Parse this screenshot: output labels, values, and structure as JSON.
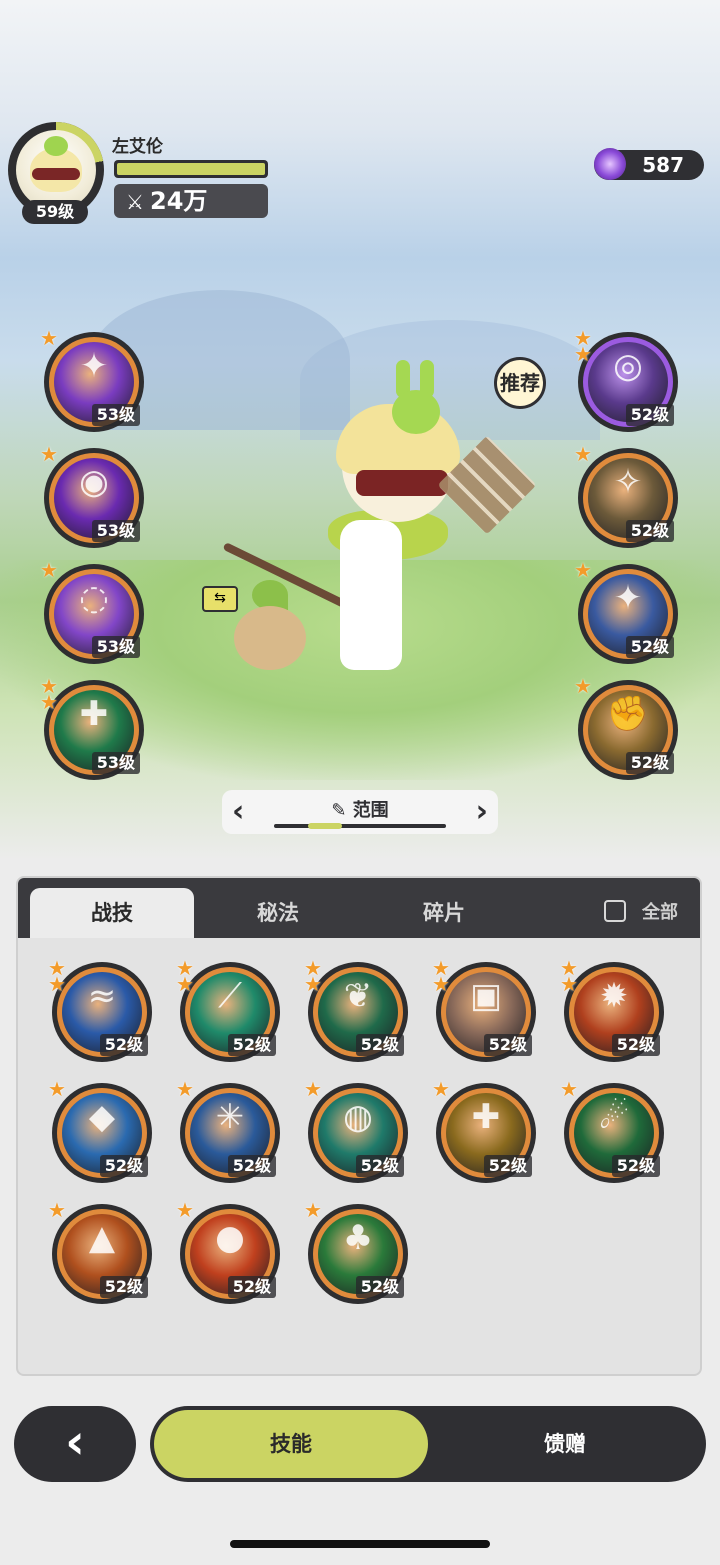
{
  "player": {
    "name": "左艾伦",
    "level": "59级",
    "power": "24万",
    "power_icon": "crossed-swords-icon",
    "xp_fraction": 0.22,
    "hp_fraction": 1.0
  },
  "currency": {
    "amount": "587",
    "icon": "purple-gem-icon"
  },
  "recommend_label": "推荐",
  "left_skills": [
    {
      "level": "53级",
      "stars": 1,
      "icon": "purple-sparkle-icon",
      "color": "#7a3cc0"
    },
    {
      "level": "53级",
      "stars": 1,
      "icon": "purple-eye-icon",
      "color": "#6a2ab0"
    },
    {
      "level": "53级",
      "stars": 1,
      "icon": "purple-swirl-icon",
      "color": "#8246c8"
    },
    {
      "level": "53级",
      "stars": 2,
      "icon": "green-cross-icon",
      "color": "#1f7a4a"
    }
  ],
  "right_skills": [
    {
      "level": "52级",
      "stars": 2,
      "icon": "purple-eye-sigil-icon",
      "color": "#5a3a8c",
      "ring": "#9b5be0"
    },
    {
      "level": "52级",
      "stars": 1,
      "icon": "golden-aura-icon",
      "color": "#6c5a3a",
      "ring": "#e08b3c"
    },
    {
      "level": "52级",
      "stars": 1,
      "icon": "blue-star-icon",
      "color": "#3a5aa0",
      "ring": "#e08b3c"
    },
    {
      "level": "52级",
      "stars": 1,
      "icon": "golden-fist-icon",
      "color": "#8a6a30",
      "ring": "#e08b3c"
    }
  ],
  "selector": {
    "label": "范围",
    "icon": "pencil-icon"
  },
  "tabs": [
    {
      "label": "战技",
      "active": true
    },
    {
      "label": "秘法",
      "active": false
    },
    {
      "label": "碎片",
      "active": false
    }
  ],
  "all_label": "全部",
  "grid_skills": [
    {
      "level": "52级",
      "stars": 2,
      "icon": "blue-wave-icon",
      "color": "#2a5aa8"
    },
    {
      "level": "52级",
      "stars": 2,
      "icon": "green-slash-icon",
      "color": "#1f8a6a"
    },
    {
      "level": "52级",
      "stars": 2,
      "icon": "thorn-vine-icon",
      "color": "#1f6a4a"
    },
    {
      "level": "52级",
      "stars": 2,
      "icon": "rock-shield-icon",
      "color": "#8a6a5a"
    },
    {
      "level": "52级",
      "stars": 2,
      "icon": "fire-blast-icon",
      "color": "#b0401e"
    },
    {
      "level": "52级",
      "stars": 1,
      "icon": "ice-shard-icon",
      "color": "#2a6ab0"
    },
    {
      "level": "52级",
      "stars": 1,
      "icon": "ice-burst-icon",
      "color": "#2a5a9a"
    },
    {
      "level": "52级",
      "stars": 1,
      "icon": "water-vortex-icon",
      "color": "#1f7a6a"
    },
    {
      "level": "52级",
      "stars": 1,
      "icon": "golden-heal-icon",
      "color": "#8a6a1e"
    },
    {
      "level": "52级",
      "stars": 1,
      "icon": "green-comet-icon",
      "color": "#1f6a3a"
    },
    {
      "level": "52级",
      "stars": 1,
      "icon": "fire-wolf-icon",
      "color": "#b0501e"
    },
    {
      "level": "52级",
      "stars": 1,
      "icon": "fire-orb-icon",
      "color": "#c0401e"
    },
    {
      "level": "52级",
      "stars": 1,
      "icon": "treant-icon",
      "color": "#2a7a3a"
    }
  ],
  "bottom": {
    "skills_label": "技能",
    "gift_label": "馈赠",
    "back_icon": "chevron-left-icon"
  },
  "colors": {
    "accent": "#cbd463",
    "dark": "#2f2f33",
    "ring_orange": "#e08b3c"
  }
}
